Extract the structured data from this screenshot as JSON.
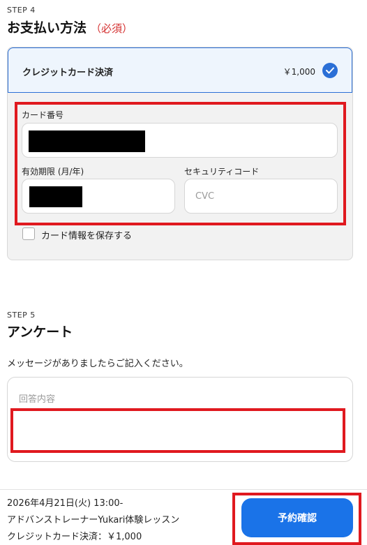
{
  "step4": {
    "step_label": "STEP 4",
    "title": "お支払い方法",
    "required": "（必須）"
  },
  "payment": {
    "method_label": "クレジットカード決済",
    "price": "￥1,000",
    "card_number_label": "カード番号",
    "expiry_label": "有効期限 (月/年)",
    "security_label": "セキュリティコード",
    "security_placeholder": "CVC",
    "save_card_label": "カード情報を保存する"
  },
  "step5": {
    "step_label": "STEP 5",
    "title": "アンケート",
    "description": "メッセージがありましたらご記入ください。",
    "answer_placeholder": "回答内容"
  },
  "footer": {
    "line1": "2026年4月21日(火) 13:00-",
    "line2": "アドバンストレーナーYukari体験レッスン",
    "line3": "クレジットカード決済：￥1,000",
    "confirm_button": "予約確認"
  },
  "colors": {
    "accent": "#1a73e8",
    "required": "#d43030",
    "highlight_frame": "#e0191f"
  }
}
